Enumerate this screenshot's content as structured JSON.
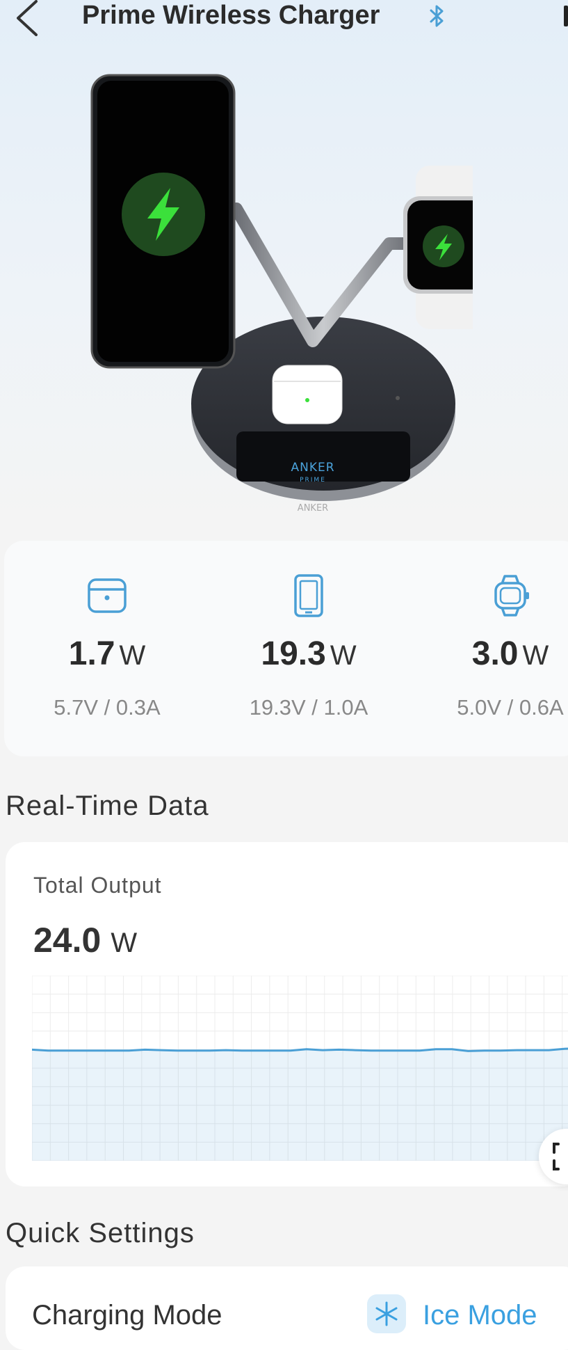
{
  "header": {
    "title": "Prime Wireless Charger",
    "back_icon": "chevron-left-icon",
    "status_icon": "bluetooth-icon"
  },
  "product": {
    "brand_primary": "ANKER",
    "brand_secondary": "PRIME",
    "brand_base": "ANKER"
  },
  "stats": [
    {
      "icon": "earbuds-case-icon",
      "watts": "1.7",
      "unit": "W",
      "va": "5.7V / 0.3A"
    },
    {
      "icon": "phone-icon",
      "watts": "19.3",
      "unit": "W",
      "va": "19.3V / 1.0A"
    },
    {
      "icon": "watch-icon",
      "watts": "3.0",
      "unit": "W",
      "va": "5.0V / 0.6A"
    }
  ],
  "realtime": {
    "heading": "Real-Time Data",
    "label": "Total Output",
    "value": "24.0",
    "unit": "W"
  },
  "chart_data": {
    "type": "area",
    "y": [
      24.0,
      23.8,
      23.8,
      23.8,
      23.8,
      23.8,
      23.8,
      24.0,
      23.9,
      23.8,
      23.8,
      23.8,
      23.9,
      23.8,
      23.8,
      23.8,
      23.8,
      24.1,
      23.9,
      24.0,
      23.9,
      23.8,
      23.8,
      23.8,
      23.8,
      24.1,
      24.1,
      23.7,
      23.8,
      23.8,
      23.9,
      23.9,
      23.9,
      24.2,
      24.3
    ],
    "ylim": [
      0,
      40
    ],
    "grid": true,
    "color": "#4a9fd5"
  },
  "quick_settings": {
    "heading": "Quick Settings",
    "charging_mode_label": "Charging Mode",
    "mode_value": "Ice Mode",
    "mode_icon": "snowflake-icon"
  },
  "colors": {
    "accent": "#4a9fd5",
    "charging_green": "#3be03b"
  }
}
